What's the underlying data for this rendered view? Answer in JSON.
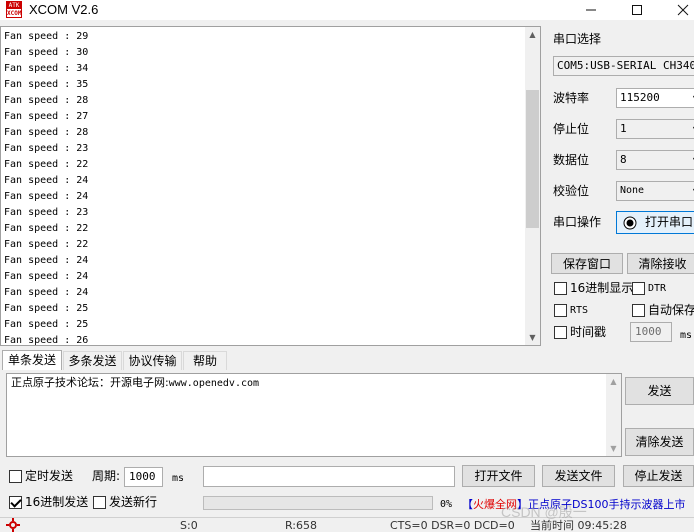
{
  "window": {
    "title": "XCOM V2.6",
    "logo_text_top": "ATK",
    "logo_text_bottom": "XCOM"
  },
  "receive": {
    "lines": [
      "Fan speed : 29",
      "Fan speed : 30",
      "Fan speed : 34",
      "Fan speed : 35",
      "Fan speed : 28",
      "Fan speed : 27",
      "Fan speed : 28",
      "Fan speed : 23",
      "Fan speed : 22",
      "Fan speed : 24",
      "Fan speed : 24",
      "Fan speed : 23",
      "Fan speed : 22",
      "Fan speed : 22",
      "Fan speed : 24",
      "Fan speed : 24",
      "Fan speed : 24",
      "Fan speed : 25",
      "Fan speed : 25",
      "Fan speed : 26"
    ]
  },
  "settings": {
    "port_select_label": "串口选择",
    "port_value": "COM5:USB-SERIAL CH340",
    "baud_label": "波特率",
    "baud_value": "115200",
    "stop_bits_label": "停止位",
    "stop_bits_value": "1",
    "data_bits_label": "数据位",
    "data_bits_value": "8",
    "parity_label": "校验位",
    "parity_value": "None",
    "port_op_label": "串口操作",
    "open_port_button": "打开串口",
    "save_window_button": "保存窗口",
    "clear_receive_button": "清除接收",
    "hex_display_label": "16进制显示",
    "dtr_label": "DTR",
    "rts_label": "RTS",
    "auto_save_label": "自动保存",
    "timestamp_label": "时间戳",
    "timestamp_ms_value": "1000",
    "timestamp_ms_unit": "ms"
  },
  "tabs": [
    {
      "label": "单条发送",
      "active": true
    },
    {
      "label": "多条发送",
      "active": false
    },
    {
      "label": "协议传输",
      "active": false
    },
    {
      "label": "帮助",
      "active": false
    }
  ],
  "send": {
    "text_cn": "正点原子技术论坛：开源电子网:",
    "text_url": "www.openedv.com",
    "send_button": "发送",
    "clear_send_button": "清除发送",
    "timed_send_label": "定时发送",
    "period_label": "周期:",
    "period_value": "1000",
    "period_unit": "ms",
    "file_path_value": "",
    "open_file_button": "打开文件",
    "send_file_button": "发送文件",
    "stop_send_button": "停止发送",
    "hex_send_label": "16进制发送",
    "send_newline_label": "发送新行",
    "progress_percent": 0,
    "progress_label": "0%",
    "ad_bracket_open": "【",
    "ad_red": "火爆全网",
    "ad_rest": "】正点原子DS100手持示波器上市"
  },
  "status_bar": {
    "s": "S:0",
    "r": "R:658",
    "cts_dsr": "CTS=0 DSR=0 DCD=0",
    "time": "当前时间 09:45:28"
  },
  "watermark": "CSDN @殷一",
  "colors": {
    "progress_fill": "#06b025",
    "ad_red": "#e00000",
    "ad_blue": "#0000cc"
  }
}
